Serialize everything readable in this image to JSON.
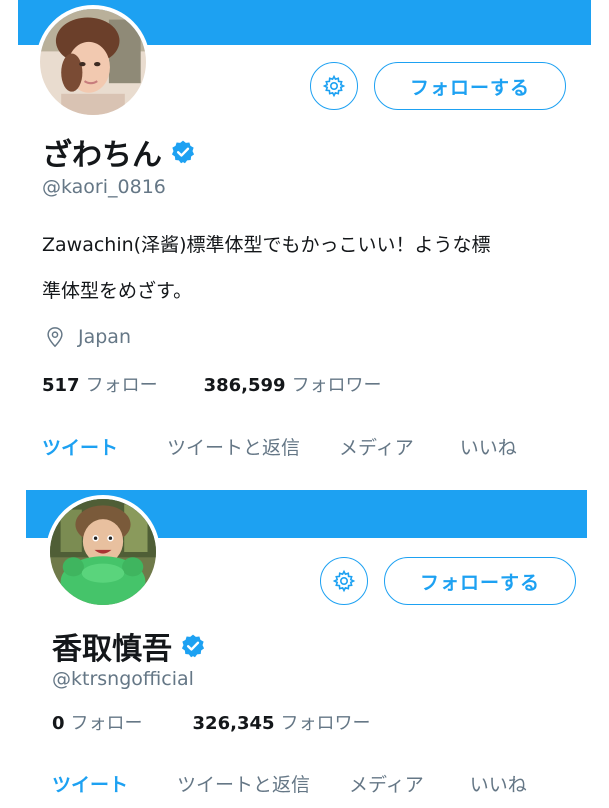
{
  "profiles": [
    {
      "name": "ざわちん",
      "handle": "@kaori_0816",
      "bio_line1": "Zawachin(泽酱)標準体型でもかっこいい！ような標",
      "bio_line2": "準体型をめざす。",
      "location": "Japan",
      "following_count": "517",
      "following_label": "フォロー",
      "followers_count": "386,599",
      "followers_label": "フォロワー",
      "follow_button": "フォローする",
      "tabs": [
        "ツイート",
        "ツイートと返信",
        "メディア",
        "いいね"
      ],
      "avatar_icon": "profile-photo-woman"
    },
    {
      "name": "香取慎吾",
      "handle": "@ktrsngofficial",
      "following_count": "0",
      "following_label": "フォロー",
      "followers_count": "326,345",
      "followers_label": "フォロワー",
      "follow_button": "フォローする",
      "tabs": [
        "ツイート",
        "ツイートと返信",
        "メディア",
        "いいね"
      ],
      "avatar_icon": "profile-photo-man-green-frog"
    }
  ],
  "colors": {
    "accent": "#1da1f2",
    "text": "#14171a",
    "muted": "#657786"
  },
  "icons": {
    "settings": "gear-icon",
    "verified": "verified-badge-icon",
    "location": "location-pin-icon"
  }
}
